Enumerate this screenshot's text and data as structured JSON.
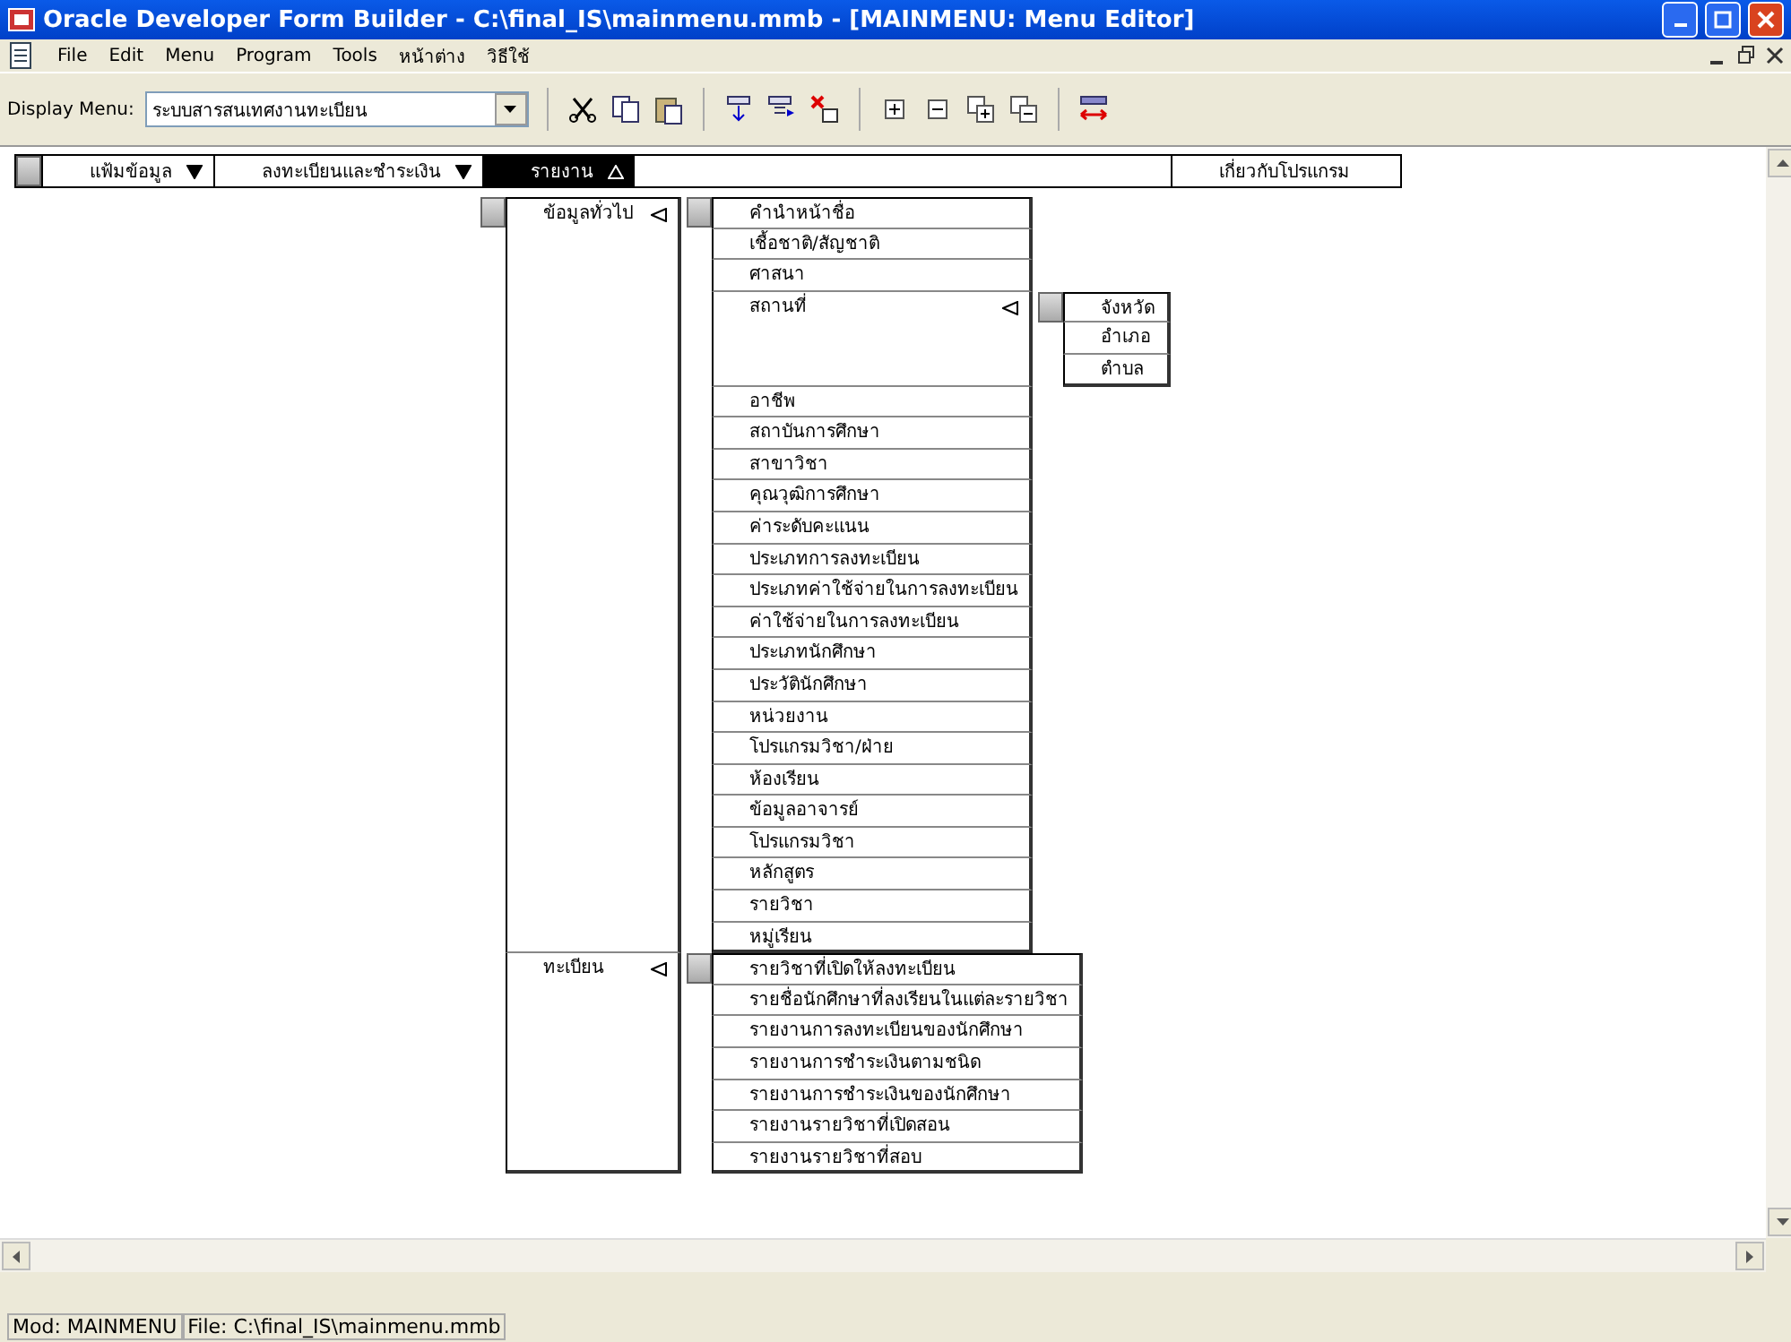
{
  "window": {
    "title": "Oracle Developer Form Builder - C:\\final_IS\\mainmenu.mmb - [MAINMENU: Menu Editor]"
  },
  "menu_bar": [
    "File",
    "Edit",
    "Menu",
    "Program",
    "Tools",
    "หน้าต่าง",
    "วิธีใช้"
  ],
  "toolbar": {
    "display_menu_label": "Display Menu:",
    "display_menu_value": "ระบบสารสนเทศงานทะเบียน"
  },
  "menu_editor": {
    "items": [
      {
        "label": "แฟ้มข้อมูล",
        "selected": false,
        "has_submenu": true,
        "expanded": false
      },
      {
        "label": "ลงทะเบียนและชำระเงิน",
        "selected": false,
        "has_submenu": true,
        "expanded": false
      },
      {
        "label": "รายงาน",
        "selected": true,
        "has_submenu": true,
        "expanded": true,
        "children": [
          {
            "label": "ข้อมูลทั่วไป",
            "has_submenu": true,
            "expanded": true,
            "children": [
              {
                "label": "คำนำหน้าชื่อ"
              },
              {
                "label": "เชื้อชาติ/สัญชาติ"
              },
              {
                "label": "ศาสนา"
              },
              {
                "label": "สถานที่",
                "has_submenu": true,
                "expanded": true,
                "children": [
                  {
                    "label": "จังหวัด"
                  },
                  {
                    "label": "อำเภอ"
                  },
                  {
                    "label": "ตำบล"
                  }
                ]
              },
              {
                "label": "อาชีพ"
              },
              {
                "label": "สถาบันการศึกษา"
              },
              {
                "label": "สาขาวิชา"
              },
              {
                "label": "คุณวุฒิการศึกษา"
              },
              {
                "label": "ค่าระดับคะแนน"
              },
              {
                "label": "ประเภทการลงทะเบียน"
              },
              {
                "label": "ประเภทค่าใช้จ่ายในการลงทะเบียน"
              },
              {
                "label": "ค่าใช้จ่ายในการลงทะเบียน"
              },
              {
                "label": "ประเภทนักศึกษา"
              },
              {
                "label": "ประวัตินักศึกษา"
              },
              {
                "label": "หน่วยงาน"
              },
              {
                "label": "โปรแกรมวิชา/ฝ่าย"
              },
              {
                "label": "ห้องเรียน"
              },
              {
                "label": "ข้อมูลอาจารย์"
              },
              {
                "label": "โปรแกรมวิชา"
              },
              {
                "label": "หลักสูตร"
              },
              {
                "label": "รายวิชา"
              },
              {
                "label": "หมู่เรียน"
              }
            ]
          },
          {
            "label": "ทะเบียน",
            "has_submenu": true,
            "expanded": true,
            "children": [
              {
                "label": "รายวิชาที่เปิดให้ลงทะเบียน"
              },
              {
                "label": "รายชื่อนักศึกษาที่ลงเรียนในแต่ละรายวิชา"
              },
              {
                "label": "รายงานการลงทะเบียนของนักศึกษา"
              },
              {
                "label": "รายงานการชำระเงินตามชนิด"
              },
              {
                "label": "รายงานการชำระเงินของนักศึกษา"
              },
              {
                "label": "รายงานรายวิชาที่เปิดสอน"
              },
              {
                "label": "รายงานรายวิชาที่สอบ"
              }
            ]
          }
        ]
      },
      {
        "label": "เกี่ยวกับโปรแกรม",
        "selected": false,
        "has_submenu": false
      }
    ]
  },
  "status_bar": [
    "Mod: MAINMENU",
    "File: C:\\final_IS\\mainmenu.mmb"
  ]
}
